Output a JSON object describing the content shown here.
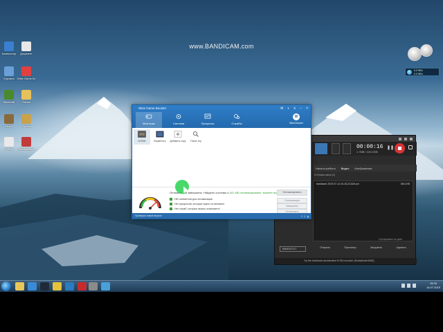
{
  "watermark": "www.BANDICAM.com",
  "desktop_icons": [
    {
      "label": "Компьютер",
      "icon": "computer-icon",
      "color": "#3a7fd0"
    },
    {
      "label": "Документ",
      "icon": "document-icon",
      "color": "#e8e8e8"
    },
    {
      "label": "Корзина",
      "icon": "recycle-bin-icon",
      "color": "#6a9fd8"
    },
    {
      "label": "Wise Game Booster",
      "icon": "wise-icon",
      "color": "#e04040"
    },
    {
      "label": "Minecraft",
      "icon": "minecraft-icon",
      "color": "#4b8a2b"
    },
    {
      "label": "Папка",
      "icon": "folder-icon",
      "color": "#e7c15a"
    },
    {
      "label": "Игры",
      "icon": "game-icon",
      "color": "#8a6a3a"
    },
    {
      "label": "Архив",
      "icon": "archive-icon",
      "color": "#c9a24a"
    },
    {
      "label": "Кубик",
      "icon": "dice-icon",
      "color": "#e9e9e9"
    },
    {
      "label": "Приложение",
      "icon": "app-icon",
      "color": "#c23b3b"
    }
  ],
  "wise": {
    "title": "Wise Game Booster",
    "nav": [
      {
        "label": "Мои игры",
        "icon": "gamepad-icon"
      },
      {
        "label": "Система",
        "icon": "gear-icon"
      },
      {
        "label": "Процессы",
        "icon": "monitor-icon"
      },
      {
        "label": "Службы",
        "icon": "services-icon"
      }
    ],
    "wisecleaner": "WiseCleaner",
    "games": [
      {
        "label": "DOOM"
      },
      {
        "label": "Вашей игр"
      },
      {
        "label": "Добавить игру"
      },
      {
        "label": "Поиск игр"
      }
    ],
    "opt_text_a": "Оптимизация ",
    "opt_text_b": "завершена. Найдено",
    "opt_mid": " системы и ",
    "opt_count": "341",
    "opt_rest": " МБ оптимизировано. Можете играть...",
    "items": [
      "Нет элементов для оптимизации",
      "Нет процессов, которые нужно остановить!",
      "Нет служб, которые можно остановить!"
    ],
    "buttons": [
      "Оптимизировать",
      "Оптимизация",
      "Завершить",
      "Остановить"
    ],
    "status": "Проверка новой версии"
  },
  "bandicam": {
    "timer": "00:00:16",
    "size": "1.7MB / 220.0GB",
    "tabs": [
      "Начало работы",
      "Видео",
      "Изображения"
    ],
    "path": "D:\\Новая папка (2)",
    "file_name": "bandicam 2019-07-14 15-15-22-626.avi",
    "file_size": "336.1KB",
    "sort_label": "Сортировать по дате",
    "actions": [
      "Открыть",
      "Просмотр",
      "Загрузить",
      "Удалить"
    ],
    "bandicut": "BANDICUT",
    "footer": "Try the hardware-accelerated H.264 encoder (Nvidia/Intel/AMD)"
  },
  "netmon": {
    "up": "0.0 КБ/с",
    "down": "0.0 КБ/с"
  },
  "tray": {
    "time": "15:16",
    "date": "14.07.2019"
  },
  "taskbar_apps": [
    {
      "icon": "explorer-icon",
      "color": "#e8c75a"
    },
    {
      "icon": "media-player-icon",
      "color": "#3a8ad6"
    },
    {
      "icon": "steam-icon",
      "color": "#1e2a3a"
    },
    {
      "icon": "chrome-icon",
      "color": "#e5c23b"
    },
    {
      "icon": "wise-game-booster-icon",
      "color": "#2a7bc0"
    },
    {
      "icon": "bandicam-icon",
      "color": "#c72c2c"
    },
    {
      "icon": "tool-icon",
      "color": "#8b8b8b"
    },
    {
      "icon": "app-icon",
      "color": "#4aa0d8"
    }
  ]
}
